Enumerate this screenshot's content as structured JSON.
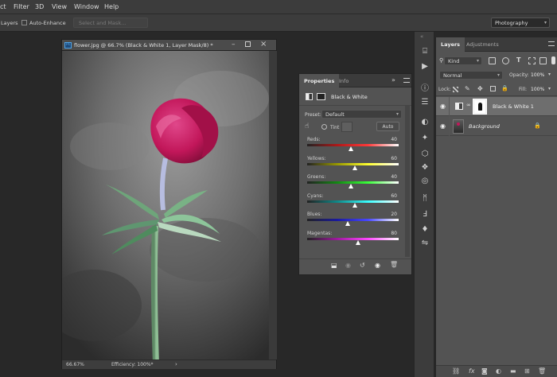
{
  "menu": [
    "ct",
    "Filter",
    "3D",
    "View",
    "Window",
    "Help"
  ],
  "options": {
    "layers_label": "Layers",
    "auto_enhance_label": "Auto-Enhance",
    "select_mask_label": "Select and Mask...",
    "workspace": "Photography"
  },
  "document": {
    "title": "flower.jpg @ 66.7% (Black & White 1, Layer Mask/8) *",
    "ps_badge": "Ps",
    "zoom": "66.67%",
    "efficiency": "Efficiency: 100%*",
    "status_arrow": "›"
  },
  "properties": {
    "tabs": [
      "Properties",
      "Info"
    ],
    "adjustment_name": "Black & White",
    "preset_label": "Preset:",
    "preset_value": "Default",
    "tint_label": "Tint",
    "auto_label": "Auto",
    "sliders": [
      {
        "label": "Reds:",
        "value": 40
      },
      {
        "label": "Yellows:",
        "value": 60
      },
      {
        "label": "Greens:",
        "value": 40
      },
      {
        "label": "Cyans:",
        "value": 60
      },
      {
        "label": "Blues:",
        "value": 20
      },
      {
        "label": "Magentas:",
        "value": 80
      }
    ]
  },
  "layers_panel": {
    "tabs": [
      "Layers",
      "Adjustments"
    ],
    "filter_kind": "Kind",
    "blend_mode": "Normal",
    "opacity_label": "Opacity:",
    "opacity_value": "100%",
    "lock_label": "Lock:",
    "fill_label": "Fill:",
    "fill_value": "100%",
    "layers": [
      {
        "name": "Black & White 1",
        "selected": true
      },
      {
        "name": "Background",
        "locked": true
      }
    ],
    "bottom_icons": [
      "link-icon",
      "fx-icon",
      "mask-icon",
      "adjustment-icon",
      "group-icon",
      "new-layer-icon",
      "trash-icon"
    ]
  },
  "colors": {
    "panel_bg": "#535353",
    "app_bg": "#282828",
    "selected_layer": "#6c6c6c",
    "flower_magenta": "#c2175a"
  }
}
